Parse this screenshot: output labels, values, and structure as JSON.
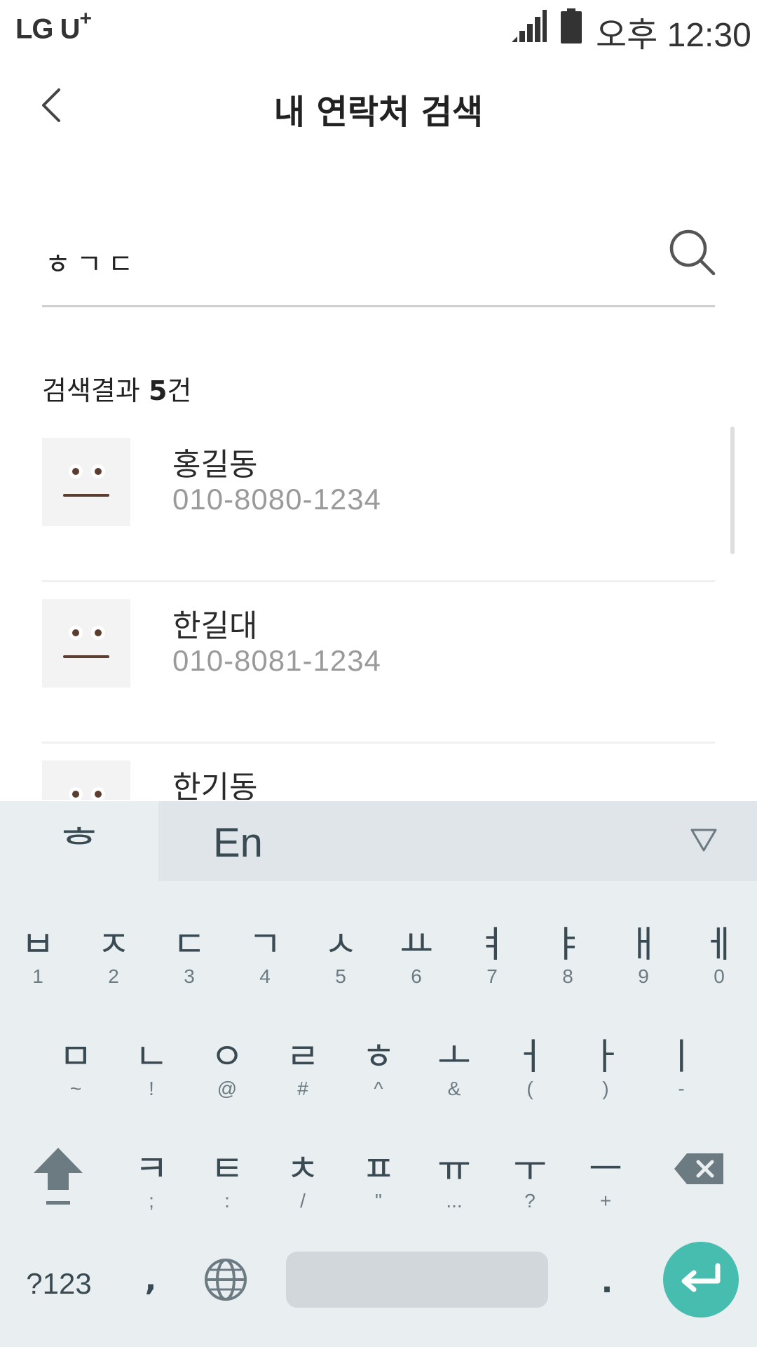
{
  "status_bar": {
    "carrier": "LG U",
    "carrier_suffix": "+",
    "time": "오후 12:30"
  },
  "header": {
    "title": "내 연락처 검색"
  },
  "search": {
    "value": "ㅎㄱㄷ",
    "placeholder": ""
  },
  "results": {
    "label": "검색결과",
    "count": "5",
    "unit": "건",
    "items": [
      {
        "name": "홍길동",
        "phone": "010-8080-1234"
      },
      {
        "name": "한길대",
        "phone": "010-8081-1234"
      },
      {
        "name": "한기동",
        "phone": ""
      }
    ]
  },
  "keyboard": {
    "lang_ko": "ᄒ",
    "lang_en": "En",
    "row1": [
      {
        "main": "ㅂ",
        "sub": "1"
      },
      {
        "main": "ㅈ",
        "sub": "2"
      },
      {
        "main": "ㄷ",
        "sub": "3"
      },
      {
        "main": "ㄱ",
        "sub": "4"
      },
      {
        "main": "ㅅ",
        "sub": "5"
      },
      {
        "main": "ㅛ",
        "sub": "6"
      },
      {
        "main": "ㅕ",
        "sub": "7"
      },
      {
        "main": "ㅑ",
        "sub": "8"
      },
      {
        "main": "ㅐ",
        "sub": "9"
      },
      {
        "main": "ㅔ",
        "sub": "0"
      }
    ],
    "row2": [
      {
        "main": "ㅁ",
        "sub": "~"
      },
      {
        "main": "ㄴ",
        "sub": "!"
      },
      {
        "main": "ㅇ",
        "sub": "@"
      },
      {
        "main": "ㄹ",
        "sub": "#"
      },
      {
        "main": "ㅎ",
        "sub": "^"
      },
      {
        "main": "ㅗ",
        "sub": "&"
      },
      {
        "main": "ㅓ",
        "sub": "("
      },
      {
        "main": "ㅏ",
        "sub": ")"
      },
      {
        "main": "ㅣ",
        "sub": "-"
      }
    ],
    "row3": [
      {
        "main": "ㅋ",
        "sub": ";"
      },
      {
        "main": "ㅌ",
        "sub": ":"
      },
      {
        "main": "ㅊ",
        "sub": "/"
      },
      {
        "main": "ㅍ",
        "sub": "\""
      },
      {
        "main": "ㅠ",
        "sub": "..."
      },
      {
        "main": "ㅜ",
        "sub": "?"
      },
      {
        "main": "ㅡ",
        "sub": "+"
      }
    ],
    "symbols_label": "?123",
    "comma": ",",
    "period": "."
  },
  "colors": {
    "accent": "#47bdb0",
    "keyboard_bg": "#e9eef1",
    "divider": "#f0f0f0"
  }
}
